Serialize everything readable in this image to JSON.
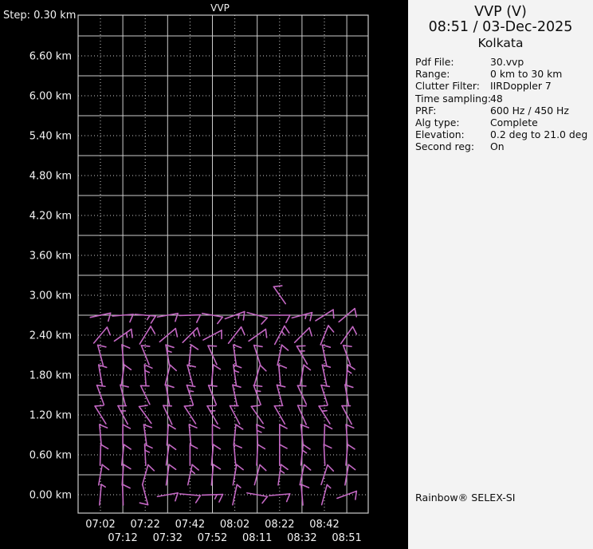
{
  "chart_data": {
    "type": "wind-barb-profile",
    "title": "VVP",
    "step_label": "Step: 0.30 km",
    "y_axis": {
      "unit": "km",
      "label_interval_km": 0.6,
      "step_km": 0.3,
      "min_km": 0.0,
      "max_km": 7.2
    },
    "y_axis_labels": [
      "6.60 km",
      "6.00 km",
      "5.40 km",
      "4.80 km",
      "4.20 km",
      "3.60 km",
      "3.00 km",
      "2.40 km",
      "1.80 km",
      "1.20 km",
      "0.60 km",
      "0.00 km"
    ],
    "x_axis_times": [
      "07:02",
      "07:12",
      "07:22",
      "07:32",
      "07:42",
      "07:52",
      "08:02",
      "08:11",
      "08:22",
      "08:32",
      "08:42",
      "08:51"
    ],
    "grid": "on",
    "label_color": "#f2f2f2",
    "grid_color": "#cccccc",
    "barb_color": "#c468c4",
    "barb_rows": [
      {
        "height_km": 3.0,
        "dirs": [
          null,
          null,
          null,
          null,
          null,
          null,
          null,
          null,
          -35,
          null,
          null,
          null
        ],
        "feathers": [
          0,
          0,
          0,
          0,
          0,
          0,
          0,
          0,
          1,
          0,
          0,
          0
        ]
      },
      {
        "height_km": 2.7,
        "dirs": [
          78,
          85,
          95,
          80,
          88,
          100,
          70,
          105,
          90,
          75,
          58,
          50
        ],
        "feathers": [
          1,
          1,
          1.5,
          1,
          1,
          1,
          1.5,
          1,
          1,
          1.5,
          1,
          1
        ]
      },
      {
        "height_km": 2.4,
        "dirs": [
          40,
          55,
          32,
          50,
          45,
          62,
          38,
          55,
          28,
          45,
          22,
          35
        ],
        "feathers": [
          1,
          1.5,
          1,
          1,
          1.5,
          1,
          1,
          1,
          1.5,
          1,
          1,
          1
        ]
      },
      {
        "height_km": 2.1,
        "dirs": [
          -15,
          -5,
          -22,
          -10,
          6,
          -25,
          -8,
          -18,
          12,
          -30,
          -12,
          -20
        ],
        "feathers": [
          1,
          1,
          1,
          1.5,
          1,
          1,
          1,
          1,
          1,
          1.5,
          1,
          1
        ]
      },
      {
        "height_km": 1.8,
        "dirs": [
          -10,
          8,
          -4,
          14,
          -15,
          5,
          -8,
          16,
          -5,
          10,
          -12,
          6
        ],
        "feathers": [
          1,
          1,
          1.5,
          1,
          1,
          1,
          1.5,
          1,
          1,
          1,
          1,
          1.5
        ]
      },
      {
        "height_km": 1.5,
        "dirs": [
          -20,
          -14,
          -26,
          -10,
          -18,
          -22,
          -12,
          -20,
          -15,
          -25,
          -18,
          -10
        ],
        "feathers": [
          1,
          1,
          1,
          1,
          1.5,
          1,
          1,
          1.5,
          1,
          1,
          1,
          1
        ]
      },
      {
        "height_km": 1.2,
        "dirs": [
          -32,
          -28,
          -36,
          -25,
          -33,
          -30,
          -28,
          -35,
          -30,
          -24,
          -32,
          -28
        ],
        "feathers": [
          1,
          1.5,
          1,
          1,
          1,
          1.5,
          1,
          1,
          1,
          1,
          1.5,
          1
        ]
      },
      {
        "height_km": 0.9,
        "dirs": [
          -5,
          0,
          -8,
          4,
          -5,
          0,
          6,
          -3,
          0,
          -6,
          2,
          -4
        ],
        "feathers": [
          1,
          1,
          1,
          1,
          1,
          1,
          1,
          1.5,
          1,
          1,
          1,
          1
        ]
      },
      {
        "height_km": 0.6,
        "dirs": [
          2,
          6,
          -3,
          8,
          0,
          5,
          -5,
          3,
          0,
          6,
          -3,
          5
        ],
        "feathers": [
          1,
          1,
          1.5,
          1,
          1,
          1,
          1,
          1,
          1,
          1.5,
          1,
          1
        ]
      },
      {
        "height_km": 0.3,
        "dirs": [
          10,
          4,
          16,
          8,
          12,
          5,
          10,
          15,
          8,
          12,
          18,
          10
        ],
        "feathers": [
          1,
          1,
          1,
          1,
          1.5,
          1,
          1,
          1,
          1.5,
          1,
          1,
          1
        ]
      },
      {
        "height_km": 0.0,
        "dirs": [
          5,
          -2,
          165,
          80,
          95,
          88,
          12,
          100,
          85,
          -5,
          15,
          70
        ],
        "feathers": [
          0.5,
          1,
          1,
          1,
          1,
          1.5,
          0.5,
          1,
          1,
          1,
          0.5,
          1
        ]
      }
    ]
  },
  "panel": {
    "title": "VVP (V)",
    "datetime": "08:51 / 03-Dec-2025",
    "station": "Kolkata",
    "info": [
      {
        "key": "Pdf File:",
        "value": "30.vvp"
      },
      {
        "key": "Range:",
        "value": "0 km to 30 km"
      },
      {
        "key": "Clutter Filter:",
        "value": "IIRDoppler 7"
      },
      {
        "key": "Time sampling:",
        "value": "48"
      },
      {
        "key": "PRF:",
        "value": "600 Hz / 450 Hz"
      },
      {
        "key": "Alg type:",
        "value": "Complete"
      },
      {
        "key": "Elevation:",
        "value": "0.2 deg to 21.0 deg"
      },
      {
        "key": "Second reg:",
        "value": "On"
      }
    ],
    "brand": "Rainbow® SELEX-SI"
  }
}
